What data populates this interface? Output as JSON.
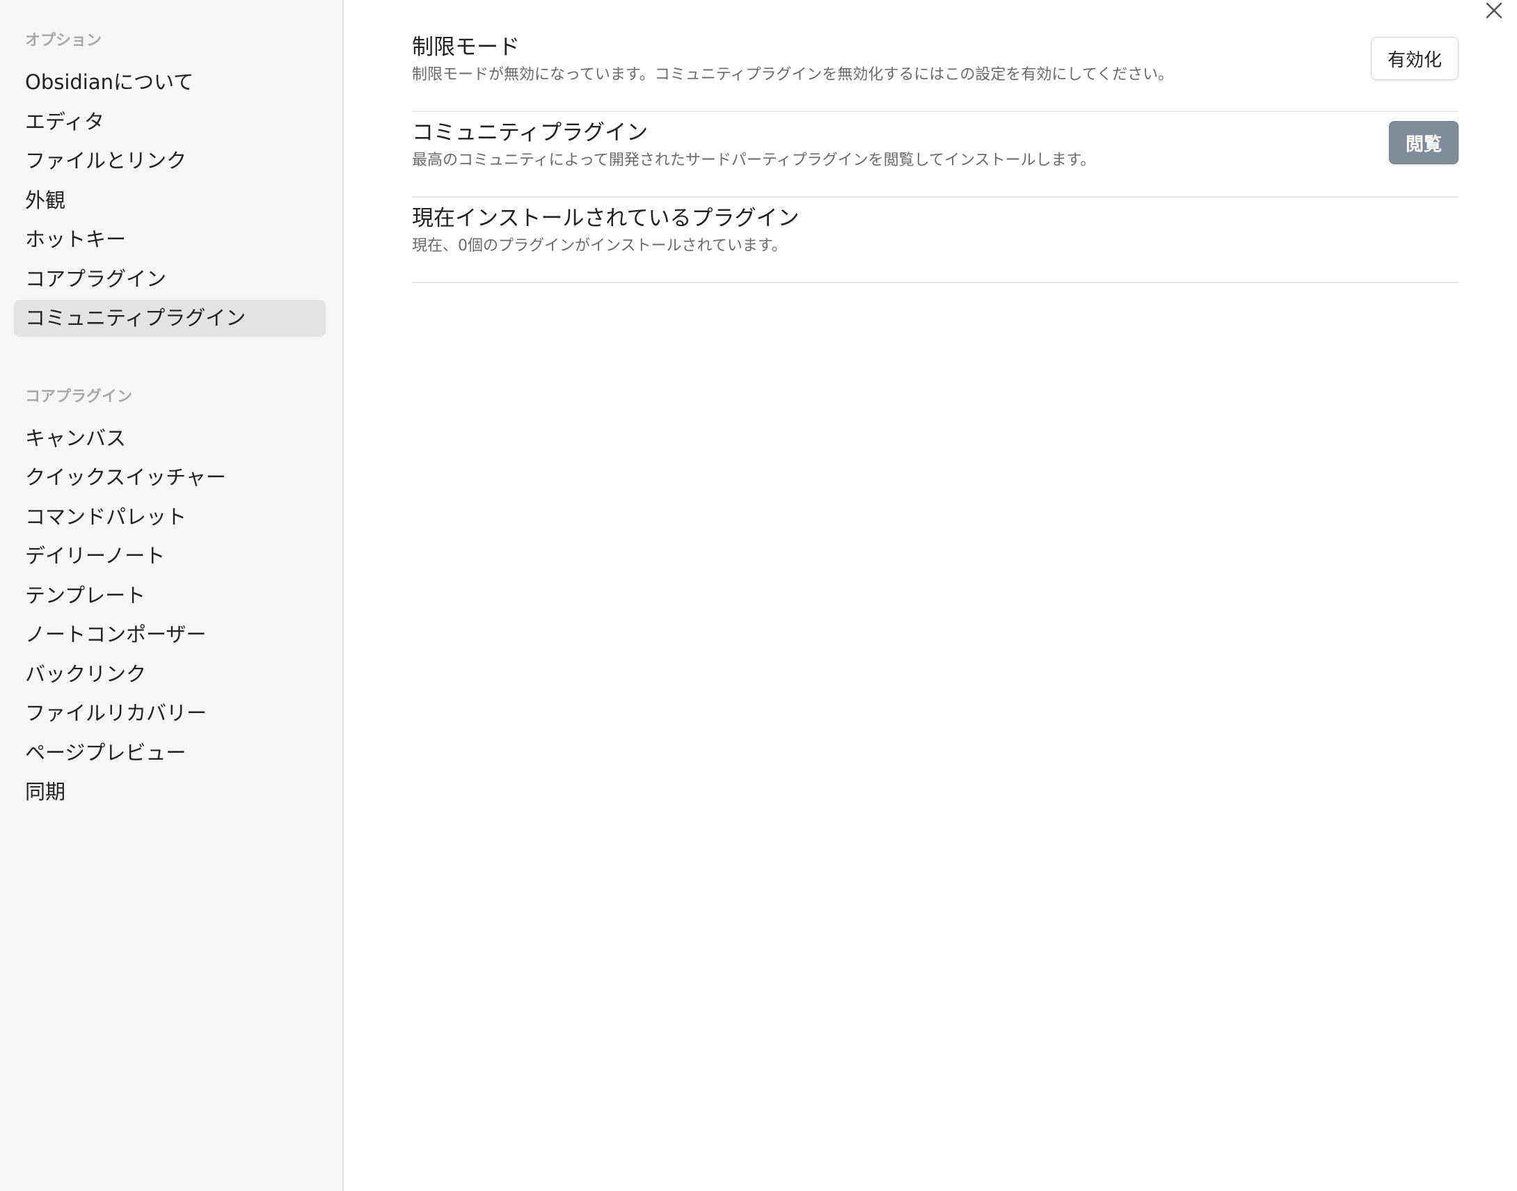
{
  "sidebar": {
    "options_heading": "オプション",
    "options_items": [
      {
        "label": "Obsidianについて"
      },
      {
        "label": "エディタ"
      },
      {
        "label": "ファイルとリンク"
      },
      {
        "label": "外観"
      },
      {
        "label": "ホットキー"
      },
      {
        "label": "コアプラグイン"
      },
      {
        "label": "コミュニティプラグイン",
        "active": true
      }
    ],
    "core_plugins_heading": "コアプラグイン",
    "core_plugins_items": [
      {
        "label": "キャンバス"
      },
      {
        "label": "クイックスイッチャー"
      },
      {
        "label": "コマンドパレット"
      },
      {
        "label": "デイリーノート"
      },
      {
        "label": "テンプレート"
      },
      {
        "label": "ノートコンポーザー"
      },
      {
        "label": "バックリンク"
      },
      {
        "label": "ファイルリカバリー"
      },
      {
        "label": "ページプレビュー"
      },
      {
        "label": "同期"
      }
    ]
  },
  "close_icon": "close-icon",
  "settings": [
    {
      "name": "制限モード",
      "description": "制限モードが無効になっています。コミュニティプラグインを無効化するにはこの設定を有効にしてください。",
      "button_label": "有効化"
    },
    {
      "name": "コミュニティプラグイン",
      "description": "最高のコミュニティによって開発されたサードパーティプラグインを閲覧してインストールします。",
      "button_label": "閲覧"
    },
    {
      "name": "現在インストールされているプラグイン",
      "description": "現在、0個のプラグインがインストールされています。"
    }
  ],
  "colors": {
    "sidebar_bg": "#f6f6f6",
    "active_item_bg": "#e3e3e3",
    "cta_button_bg": "#7f8c9a"
  }
}
